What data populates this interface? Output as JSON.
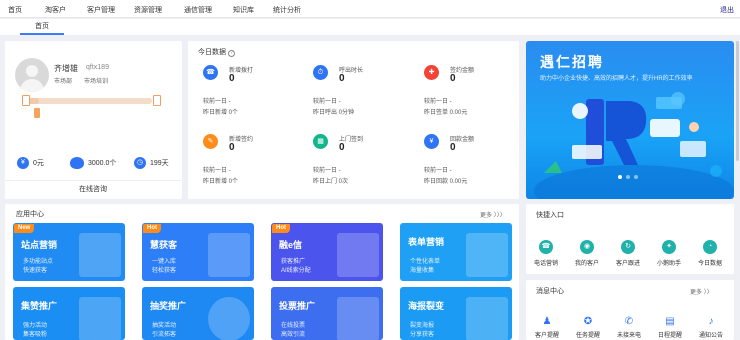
{
  "topnav": {
    "items": [
      "首页",
      "淘客户",
      "客户管理",
      "资源管理",
      "通信管理",
      "知识库",
      "统计分析"
    ],
    "logout": "退出"
  },
  "tabs": {
    "active": "首页"
  },
  "profile": {
    "name": "齐增雄",
    "user_id": "qftx189",
    "role": "市场部",
    "dept": "市场培训",
    "progress": 0.12,
    "stats": [
      {
        "icon": "coin-icon",
        "value": "0元"
      },
      {
        "icon": "egg-icon",
        "value": "3000.0个"
      },
      {
        "icon": "clock-icon",
        "value": "199天"
      }
    ],
    "consult_label": "在线咨询"
  },
  "today": {
    "title": "今日数据",
    "cells": [
      {
        "label": "新增拨打",
        "value": "0",
        "line1": "较前一日 -",
        "line2": "昨日新增 0个",
        "color": "#2f74f5",
        "icon": "phone-icon"
      },
      {
        "label": "呼出时长",
        "value": "0",
        "line1": "较前一日 -",
        "line2": "昨日呼出 0分钟",
        "color": "#2f74f5",
        "icon": "timer-icon"
      },
      {
        "label": "签约金额",
        "value": "0",
        "line1": "较前一日 -",
        "line2": "昨日签单 0.00元",
        "color": "#f44336",
        "icon": "sign-icon"
      },
      {
        "label": "新增签约",
        "value": "0",
        "line1": "较前一日 -",
        "line2": "昨日新增 0个",
        "color": "#ff8c1a",
        "icon": "contract-icon"
      },
      {
        "label": "上门签到",
        "value": "0",
        "line1": "较前一日 -",
        "line2": "昨日上门 0次",
        "color": "#13b58c",
        "icon": "checkin-icon"
      },
      {
        "label": "回款金额",
        "value": "0",
        "line1": "较前一日 -",
        "line2": "昨日回款 0.00元",
        "color": "#2f74f5",
        "icon": "money-icon"
      }
    ]
  },
  "banner": {
    "title": "遇仁招聘",
    "subtitle": "助力中小企业快捷、高效的招聘人才，提升HR的工作效率"
  },
  "apps": {
    "title": "应用中心",
    "more": "更多",
    "cards": [
      {
        "title": "站点营销",
        "desc1": "多功能站点",
        "desc2": "快速获客",
        "tag": "New",
        "bg": "#1f8bf3"
      },
      {
        "title": "慧获客",
        "desc1": "一键入库",
        "desc2": "轻松获客",
        "tag": "Hot",
        "bg": "#2d7ef7"
      },
      {
        "title": "融e信",
        "desc1": "获客推广",
        "desc2": "AI线索分配",
        "tag": "Hot",
        "bg": "#4b55ee"
      },
      {
        "title": "表单营销",
        "desc1": "个性化表单",
        "desc2": "海量收集",
        "tag": "",
        "bg": "#1fa0f5"
      },
      {
        "title": "集赞推广",
        "desc1": "强力活动",
        "desc2": "集客吸粉",
        "tag": "",
        "bg": "#1a8ef2"
      },
      {
        "title": "抽奖推广",
        "desc1": "抽奖活动",
        "desc2": "引流拓客",
        "tag": "",
        "bg": "#1e88f3"
      },
      {
        "title": "投票推广",
        "desc1": "在线投票",
        "desc2": "高效引流",
        "tag": "",
        "bg": "#3d6ef0"
      },
      {
        "title": "海报裂变",
        "desc1": "裂变海报",
        "desc2": "分享获客",
        "tag": "",
        "bg": "#1b9bf4"
      }
    ]
  },
  "quick": {
    "title": "快捷入口",
    "items": [
      {
        "label": "电话营销",
        "icon": "phone-icon"
      },
      {
        "label": "我的客户",
        "icon": "user-icon"
      },
      {
        "label": "客户跟进",
        "icon": "follow-icon"
      },
      {
        "label": "小鹅助手",
        "icon": "assistant-icon"
      },
      {
        "label": "今日数据",
        "icon": "chart-icon"
      }
    ]
  },
  "messages": {
    "title": "消息中心",
    "more": "更多",
    "items": [
      {
        "label": "客户提醒",
        "icon": "person-icon"
      },
      {
        "label": "任务提醒",
        "icon": "medal-icon"
      },
      {
        "label": "未接来电",
        "icon": "phone-icon"
      },
      {
        "label": "日程提醒",
        "icon": "calendar-icon"
      },
      {
        "label": "通知公告",
        "icon": "bell-icon"
      }
    ]
  }
}
